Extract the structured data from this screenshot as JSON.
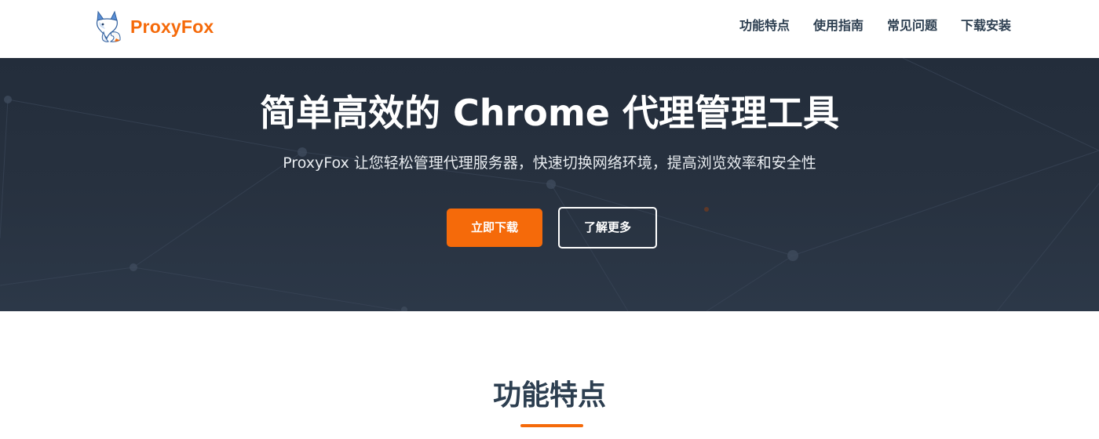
{
  "brand": {
    "name": "ProxyFox",
    "accent": "#f56a0a"
  },
  "nav": {
    "items": [
      {
        "label": "功能特点"
      },
      {
        "label": "使用指南"
      },
      {
        "label": "常见问题"
      },
      {
        "label": "下载安装"
      }
    ]
  },
  "hero": {
    "title": "简单高效的 Chrome 代理管理工具",
    "subtitle": "ProxyFox 让您轻松管理代理服务器，快速切换网络环境，提高浏览效率和安全性",
    "primary_button": "立即下载",
    "secondary_button": "了解更多",
    "background": "#27313f"
  },
  "features": {
    "title": "功能特点"
  }
}
